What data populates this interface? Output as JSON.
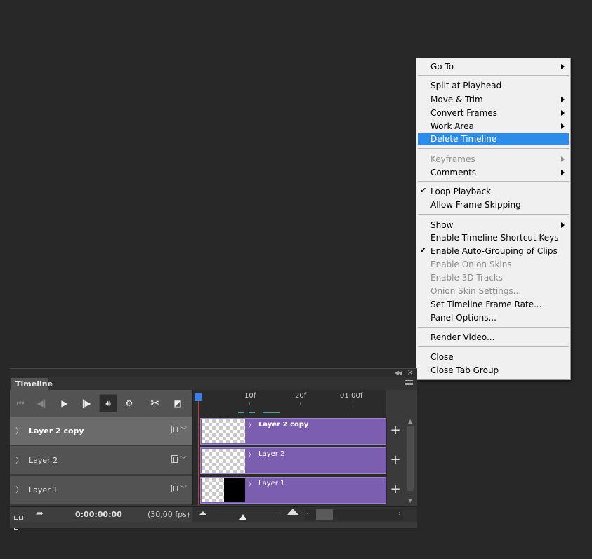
{
  "menu": {
    "items": [
      {
        "label": "Go To",
        "submenu": true,
        "disabled": false,
        "checked": false,
        "highlighted": false
      },
      {
        "label": "Split at Playhead",
        "submenu": false,
        "disabled": false,
        "checked": false,
        "highlighted": false
      },
      {
        "label": "Move & Trim",
        "submenu": true,
        "disabled": false,
        "checked": false,
        "highlighted": false
      },
      {
        "label": "Convert Frames",
        "submenu": true,
        "disabled": false,
        "checked": false,
        "highlighted": false
      },
      {
        "label": "Work Area",
        "submenu": true,
        "disabled": false,
        "checked": false,
        "highlighted": false
      },
      {
        "label": "Delete Timeline",
        "submenu": false,
        "disabled": false,
        "checked": false,
        "highlighted": true
      },
      {
        "label": "Keyframes",
        "submenu": true,
        "disabled": true,
        "checked": false,
        "highlighted": false
      },
      {
        "label": "Comments",
        "submenu": true,
        "disabled": false,
        "checked": false,
        "highlighted": false
      },
      {
        "label": "Loop Playback",
        "submenu": false,
        "disabled": false,
        "checked": true,
        "highlighted": false
      },
      {
        "label": "Allow Frame Skipping",
        "submenu": false,
        "disabled": false,
        "checked": false,
        "highlighted": false
      },
      {
        "label": "Show",
        "submenu": true,
        "disabled": false,
        "checked": false,
        "highlighted": false
      },
      {
        "label": "Enable Timeline Shortcut Keys",
        "submenu": false,
        "disabled": false,
        "checked": false,
        "highlighted": false
      },
      {
        "label": "Enable Auto-Grouping of Clips",
        "submenu": false,
        "disabled": false,
        "checked": true,
        "highlighted": false
      },
      {
        "label": "Enable Onion Skins",
        "submenu": false,
        "disabled": true,
        "checked": false,
        "highlighted": false
      },
      {
        "label": "Enable 3D Tracks",
        "submenu": false,
        "disabled": true,
        "checked": false,
        "highlighted": false
      },
      {
        "label": "Onion Skin Settings...",
        "submenu": false,
        "disabled": true,
        "checked": false,
        "highlighted": false
      },
      {
        "label": "Set Timeline Frame Rate...",
        "submenu": false,
        "disabled": false,
        "checked": false,
        "highlighted": false
      },
      {
        "label": "Panel Options...",
        "submenu": false,
        "disabled": false,
        "checked": false,
        "highlighted": false
      },
      {
        "label": "Render Video...",
        "submenu": false,
        "disabled": false,
        "checked": false,
        "highlighted": false
      },
      {
        "label": "Close",
        "submenu": false,
        "disabled": false,
        "checked": false,
        "highlighted": false
      },
      {
        "label": "Close Tab Group",
        "submenu": false,
        "disabled": false,
        "checked": false,
        "highlighted": false
      }
    ],
    "check_glyph": "✔",
    "highlight_color": "#2d8ce9"
  },
  "timeline": {
    "tab_label": "Timeline",
    "ruler": {
      "labels": [
        "10f",
        "20f",
        "01:00f"
      ]
    },
    "layers": [
      {
        "name": "Layer 2 copy",
        "selected": true,
        "clip_label": "Layer 2 copy",
        "thumb": "transparent"
      },
      {
        "name": "Layer 2",
        "selected": false,
        "clip_label": "Layer 2",
        "thumb": "transparent"
      },
      {
        "name": "Layer 1",
        "selected": false,
        "clip_label": "Layer 1",
        "thumb": "black"
      }
    ],
    "timecode": "0:00:00:00",
    "fps": "(30,00 fps)",
    "clip_color": "#7b5eb0",
    "icons": {
      "first_frame": "first-frame-icon",
      "prev_frame": "previous-frame-icon",
      "play": "play-icon",
      "next_frame": "next-frame-icon",
      "audio": "speaker-icon",
      "settings": "gear-icon",
      "split": "scissors-icon",
      "transition": "transition-icon"
    }
  }
}
